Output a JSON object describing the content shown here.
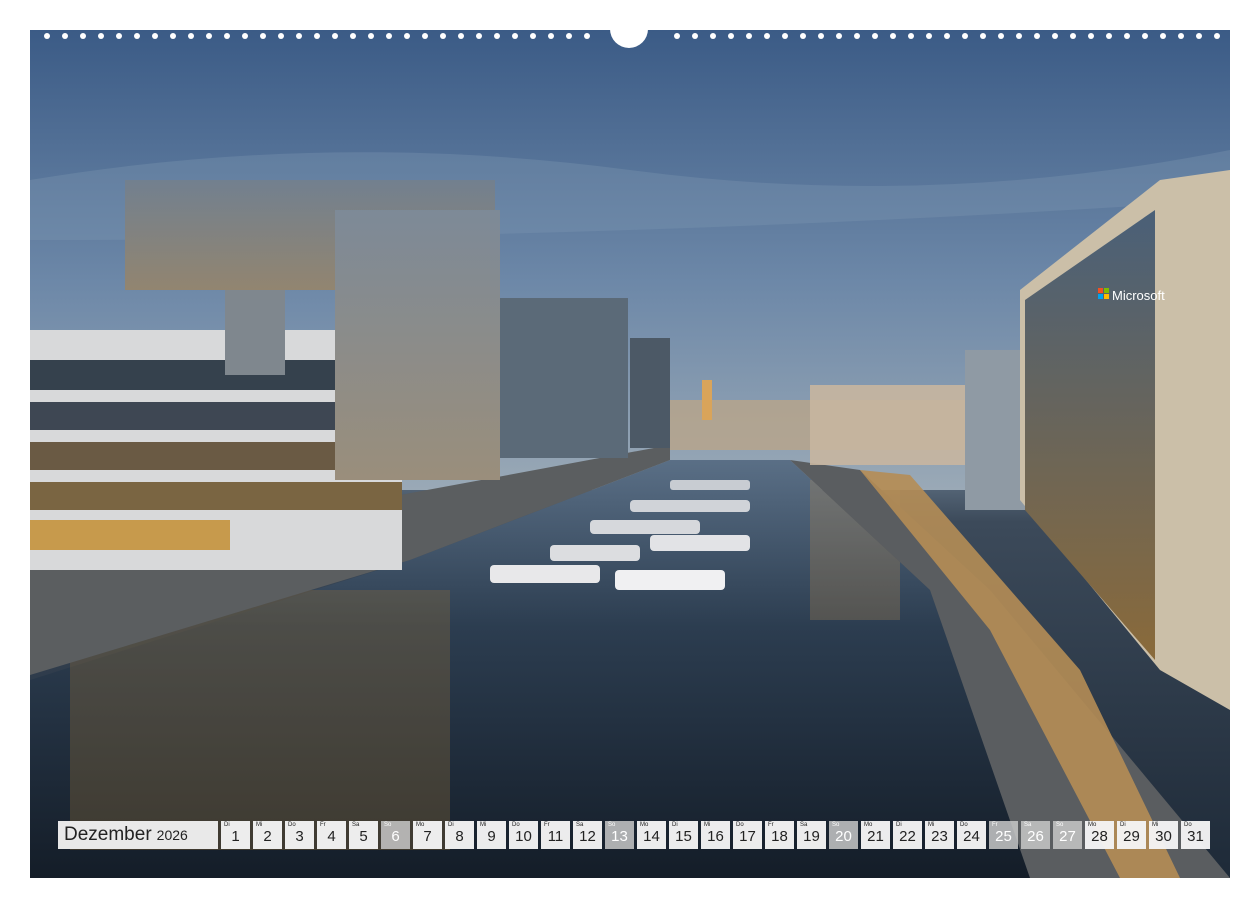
{
  "calendar": {
    "month": "Dezember",
    "year": "2026",
    "days": [
      {
        "wd": "Di",
        "n": "1",
        "we": false
      },
      {
        "wd": "Mi",
        "n": "2",
        "we": false
      },
      {
        "wd": "Do",
        "n": "3",
        "we": false
      },
      {
        "wd": "Fr",
        "n": "4",
        "we": false
      },
      {
        "wd": "Sa",
        "n": "5",
        "we": false
      },
      {
        "wd": "So",
        "n": "6",
        "we": true
      },
      {
        "wd": "Mo",
        "n": "7",
        "we": false
      },
      {
        "wd": "Di",
        "n": "8",
        "we": false
      },
      {
        "wd": "Mi",
        "n": "9",
        "we": false
      },
      {
        "wd": "Do",
        "n": "10",
        "we": false
      },
      {
        "wd": "Fr",
        "n": "11",
        "we": false
      },
      {
        "wd": "Sa",
        "n": "12",
        "we": false
      },
      {
        "wd": "So",
        "n": "13",
        "we": true
      },
      {
        "wd": "Mo",
        "n": "14",
        "we": false
      },
      {
        "wd": "Di",
        "n": "15",
        "we": false
      },
      {
        "wd": "Mi",
        "n": "16",
        "we": false
      },
      {
        "wd": "Do",
        "n": "17",
        "we": false
      },
      {
        "wd": "Fr",
        "n": "18",
        "we": false
      },
      {
        "wd": "Sa",
        "n": "19",
        "we": false
      },
      {
        "wd": "So",
        "n": "20",
        "we": true
      },
      {
        "wd": "Mo",
        "n": "21",
        "we": false
      },
      {
        "wd": "Di",
        "n": "22",
        "we": false
      },
      {
        "wd": "Mi",
        "n": "23",
        "we": false
      },
      {
        "wd": "Do",
        "n": "24",
        "we": false
      },
      {
        "wd": "Fr",
        "n": "25",
        "we": true
      },
      {
        "wd": "Sa",
        "n": "26",
        "we": true
      },
      {
        "wd": "So",
        "n": "27",
        "we": true
      },
      {
        "wd": "Mo",
        "n": "28",
        "we": false
      },
      {
        "wd": "Di",
        "n": "29",
        "we": false
      },
      {
        "wd": "Mi",
        "n": "30",
        "we": false
      },
      {
        "wd": "Do",
        "n": "31",
        "we": false
      }
    ]
  },
  "photo": {
    "sign_text": "Microsoft",
    "colors": {
      "sky": "#4d6b92",
      "water": "#1f2d3d",
      "lights": "#f2b54a",
      "building": "#c9ccd0"
    }
  }
}
